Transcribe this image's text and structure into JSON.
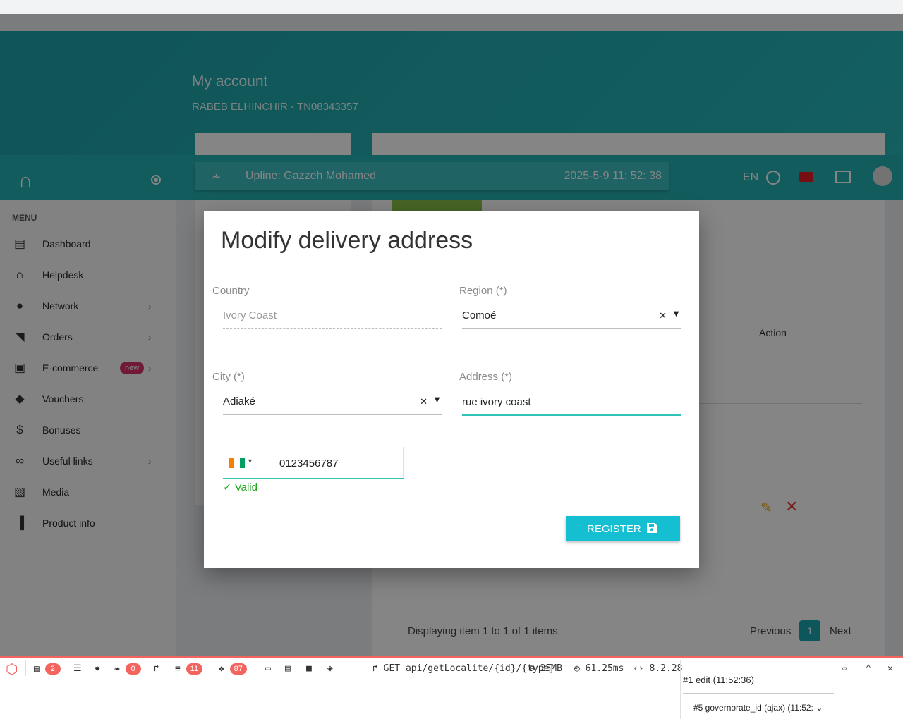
{
  "header": {
    "title": "My account",
    "subtitle": "RABEB ELHINCHIR - TN08343357"
  },
  "topbar": {
    "upline": "Upline: Gazzeh Mohamed",
    "datetime": "2025-5-9 11: 52: 38",
    "language": "EN"
  },
  "sidebar": {
    "menu_title": "MENU",
    "items": [
      {
        "label": "Dashboard",
        "icon": "dashboard-icon",
        "chevron": false
      },
      {
        "label": "Helpdesk",
        "icon": "headset-icon",
        "chevron": false
      },
      {
        "label": "Network",
        "icon": "people-icon",
        "chevron": true
      },
      {
        "label": "Orders",
        "icon": "cart-icon",
        "chevron": true
      },
      {
        "label": "E-commerce",
        "icon": "store-icon",
        "chevron": true,
        "badge": "new"
      },
      {
        "label": "Vouchers",
        "icon": "voucher-icon",
        "chevron": false
      },
      {
        "label": "Bonuses",
        "icon": "dollar-icon",
        "chevron": false
      },
      {
        "label": "Useful links",
        "icon": "infinity-icon",
        "chevron": true
      },
      {
        "label": "Media",
        "icon": "media-icon",
        "chevron": false
      },
      {
        "label": "Product info",
        "icon": "bar-chart-icon",
        "chevron": false
      }
    ]
  },
  "background": {
    "action_header": "Action",
    "pager": {
      "summary": "Displaying item 1 to 1 of 1 items",
      "previous": "Previous",
      "current_page": "1",
      "next": "Next"
    }
  },
  "modal": {
    "title": "Modify delivery address",
    "country": {
      "label": "Country",
      "value": "Ivory Coast"
    },
    "region": {
      "label": "Region (*)",
      "value": "Comoé"
    },
    "city": {
      "label": "City (*)",
      "value": "Adiaké"
    },
    "address": {
      "label": "Address (*)",
      "value": "rue ivory coast"
    },
    "phone": {
      "value": "0123456787",
      "validation": "✓ Valid"
    },
    "submit_label": "REGISTER",
    "colors": {
      "accent": "#13bfd1",
      "focus": "#2ec4b6",
      "valid": "#1aa51a"
    }
  },
  "debugbar": {
    "messages_count": "2",
    "exceptions_count": "0",
    "queries_count": "11",
    "models_count": "87",
    "route": "GET api/getLocalite/{id}/{type}",
    "memory": "25MB",
    "time": "61.25ms",
    "php_version": "8.2.28",
    "request_current": "#1 edit (11:52:36)",
    "request_ajax": "#5 governorate_id (ajax) (11:52:"
  }
}
